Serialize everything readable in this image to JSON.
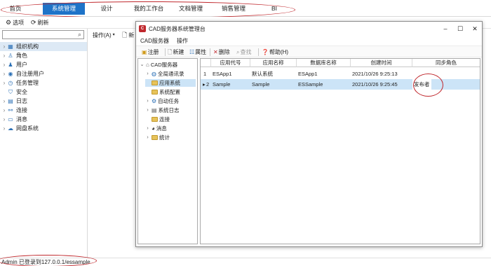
{
  "topnav": {
    "tabs": [
      {
        "label": "首页"
      },
      {
        "label": "系统管理"
      },
      {
        "label": "设计"
      },
      {
        "label": "我的工作台"
      },
      {
        "label": "文档管理"
      },
      {
        "label": "销售管理"
      },
      {
        "label": "BI"
      }
    ]
  },
  "toolbar": {
    "options_label": "选项",
    "refresh_label": "刷新"
  },
  "leftpanel": {
    "items": [
      {
        "label": "组织机构",
        "icon": "org-icon"
      },
      {
        "label": "角色",
        "icon": "roles-icon"
      },
      {
        "label": "用户",
        "icon": "user-icon"
      },
      {
        "label": "自注册用户",
        "icon": "self-register-icon"
      },
      {
        "label": "任务管理",
        "icon": "task-icon"
      },
      {
        "label": "安全",
        "icon": "shield-icon"
      },
      {
        "label": "日志",
        "icon": "log-icon"
      },
      {
        "label": "连接",
        "icon": "link-icon"
      },
      {
        "label": "消息",
        "icon": "message-icon"
      },
      {
        "label": "网盘系统",
        "icon": "cloud-icon"
      }
    ]
  },
  "optoolbar": {
    "operation_label": "操作(A)",
    "new_label": "新"
  },
  "window": {
    "title": "CAD服务器系统管理台",
    "menu": [
      "CAD服务器",
      "操作"
    ],
    "tools": {
      "register": "注册",
      "new": "新建",
      "properties": "属性",
      "delete": "删除",
      "find": "查找",
      "help": "帮助(H)"
    },
    "tree": {
      "root": "CAD服务器",
      "nodes": [
        "全局通讯录",
        "应用系统",
        "系统配置",
        "自动任务",
        "系统日志",
        "连接",
        "消息",
        "统计"
      ]
    },
    "grid": {
      "headers": [
        "应用代号",
        "应用名称",
        "数据库名称",
        "创建时间",
        "同步角色"
      ],
      "rows": [
        {
          "num": "1",
          "code": "ESApp1",
          "name": "默认系统",
          "db": "ESApp1",
          "created": "2021/10/26 9:25:13",
          "role": ""
        },
        {
          "num": "2",
          "code": "Sample",
          "name": "Sample",
          "db": "ESSample",
          "created": "2021/10/26 9:25:45",
          "role": "发布者"
        }
      ]
    }
  },
  "status": {
    "text": "Admin 已登录到127.0.0.1/essample"
  },
  "colors": {
    "accent": "#1e73c8",
    "annotation": "#c0282d",
    "selection": "#cce4f7"
  }
}
